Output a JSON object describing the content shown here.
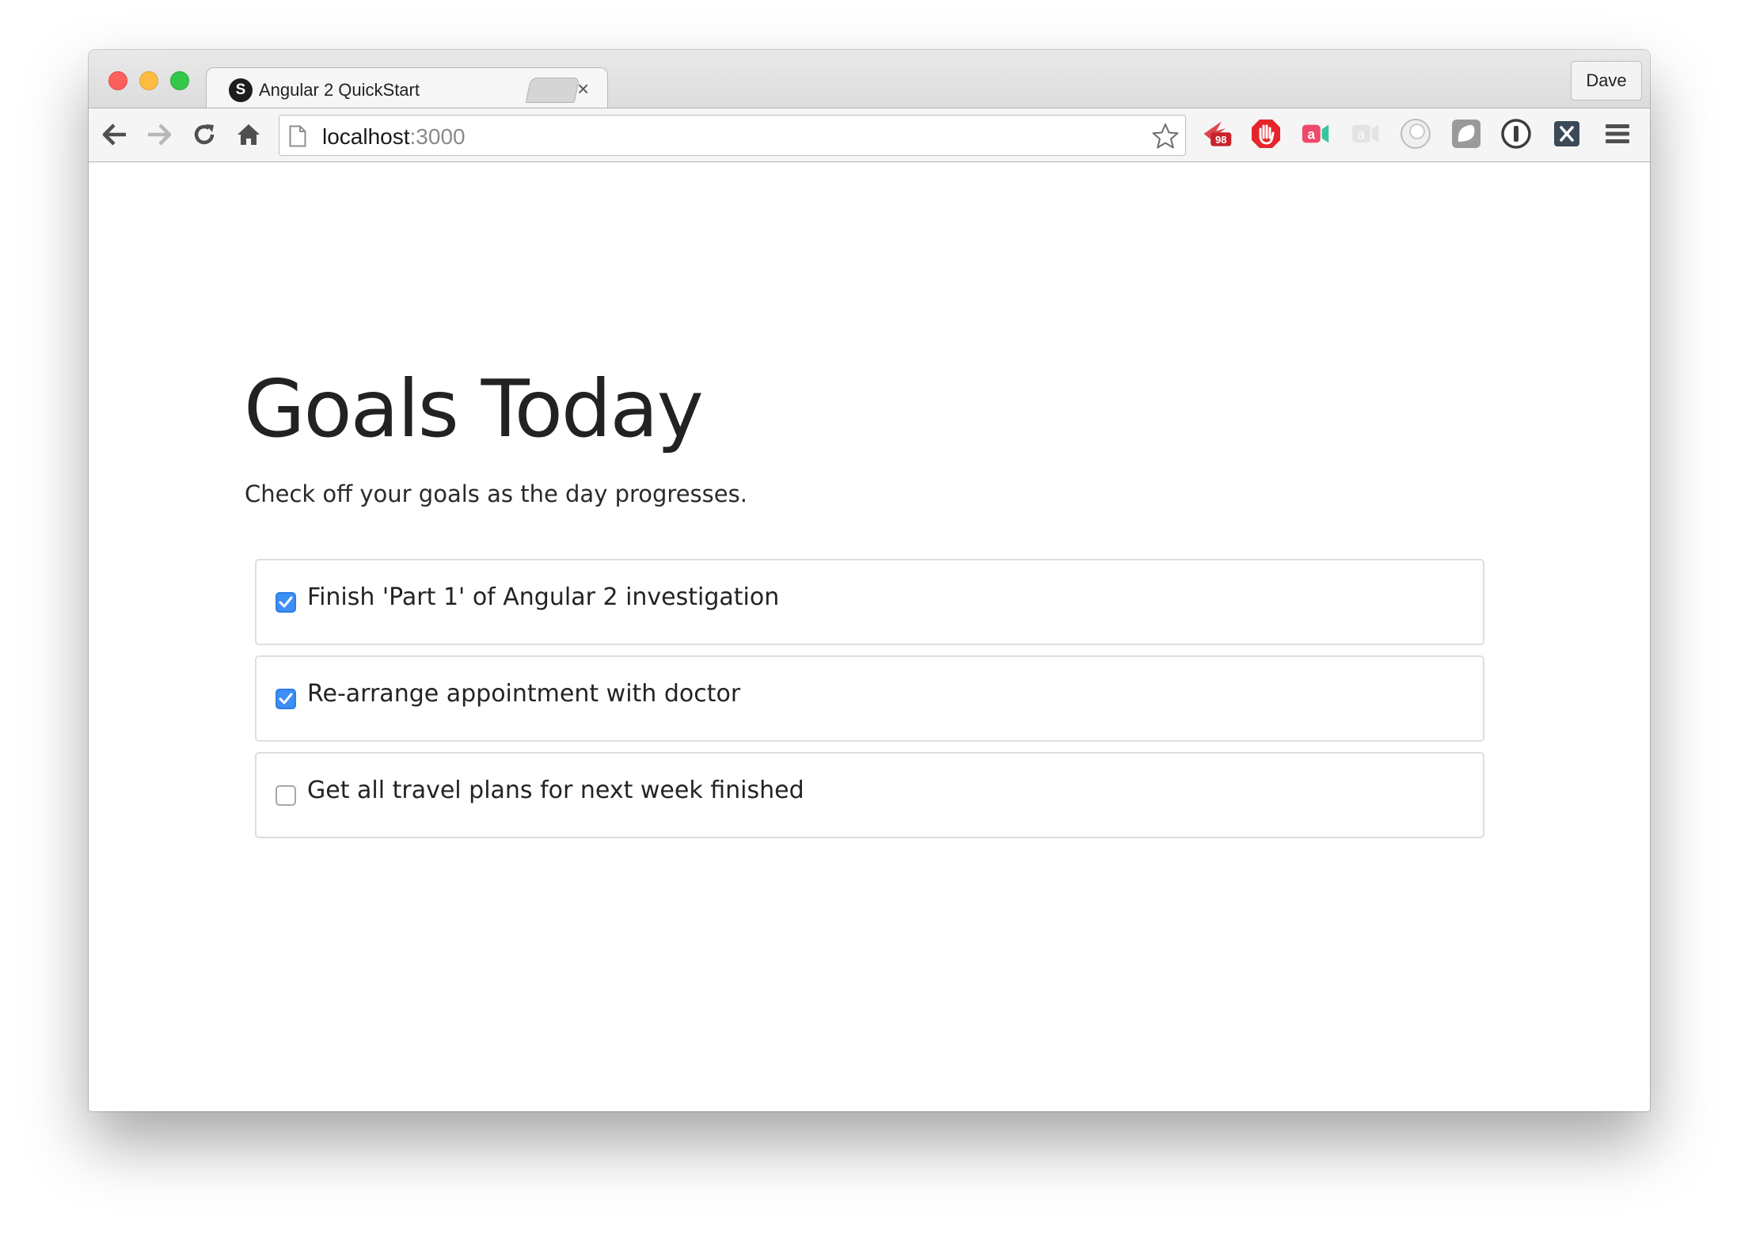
{
  "browser": {
    "tab": {
      "title": "Angular 2 QuickStart",
      "favicon_letter": "S",
      "close_glyph": "×"
    },
    "profile_name": "Dave",
    "address": {
      "host": "localhost",
      "port": ":3000"
    },
    "extension_badge": "98"
  },
  "page": {
    "title": "Goals Today",
    "subtitle": "Check off your goals as the day progresses.",
    "goals": [
      {
        "label": "Finish 'Part 1' of Angular 2 investigation",
        "checked": true
      },
      {
        "label": "Re-arrange appointment with doctor",
        "checked": true
      },
      {
        "label": "Get all travel plans for next week finished",
        "checked": false
      }
    ]
  },
  "colors": {
    "checkbox_checked": "#3d8ff6",
    "traffic_red": "#fc605c",
    "traffic_yellow": "#fdbc40",
    "traffic_green": "#34c84a"
  }
}
